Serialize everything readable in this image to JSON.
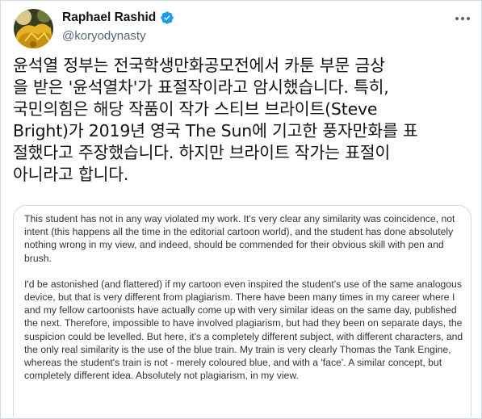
{
  "author": {
    "display_name": "Raphael Rashid",
    "handle": "@koryodynasty"
  },
  "tweet": {
    "text": "윤석열 정부는 전국학생만화공모전에서 카툰 부문 금상\n을 받은 '윤석열차'가 표절작이라고 암시했습니다. 특히,\n국민의힘은 해당 작품이 작가 스티브 브라이트(Steve\nBright)가 2019년 영국 The Sun에 기고한 풍자만화를 표\n절했다고 주장했습니다. 하지만 브라이트 작가는 표절이\n아니라고 합니다."
  },
  "image": {
    "paragraph_1": "This student has not in any way violated my work. It's very clear any similarity was coincidence, not intent (this happens all the time in the editorial cartoon world), and the student has done absolutely nothing wrong in my view, and indeed, should be commended for their obvious skill with pen and brush.",
    "paragraph_2": "I'd be astonished (and flattered) if my cartoon even inspired the student's use of the same analogous device, but that is very different from plagiarism. There have been many times in my career where I and my fellow cartoonists have actually come up with very similar ideas on the same day, published the next. Therefore, impossible to have involved plagiarism, but had they been on separate days, the suspicion could be levelled.  But here, it's a completely different subject, with different characters, and the only real similarity is the use of the blue train. My train is very clearly Thomas the Tank Engine, whereas the student's train is not - merely coloured blue, and with a 'face'. A similar concept, but completely different idea. Absolutely not plagiarism, in my view."
  },
  "icons": {
    "verified": "verified-badge-icon",
    "more": "more-options-icon"
  },
  "colors": {
    "verified_blue": "#1d9bf0",
    "secondary_text": "#536471",
    "border": "#cfd9de"
  }
}
